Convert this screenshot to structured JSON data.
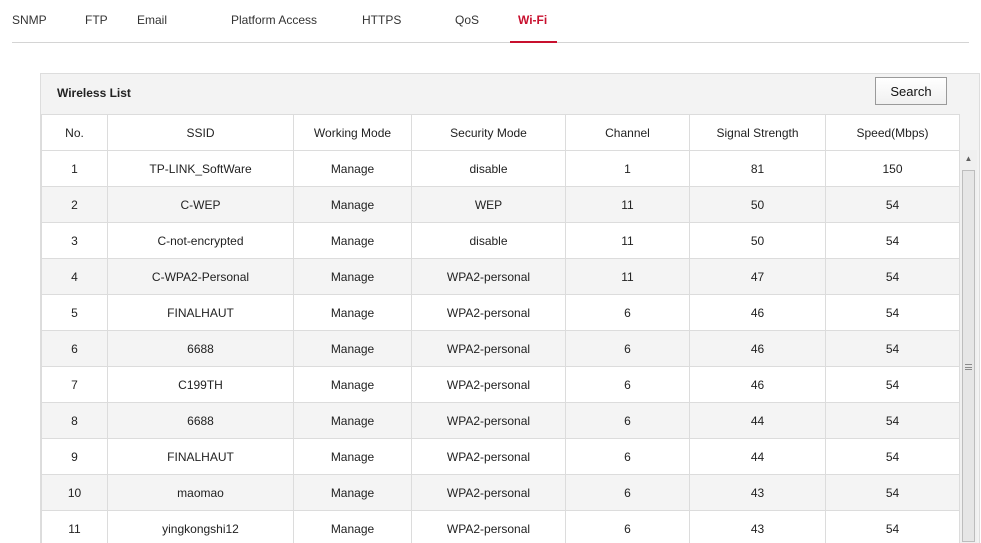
{
  "tabs": [
    {
      "label": "SNMP",
      "active": false
    },
    {
      "label": "FTP",
      "active": false
    },
    {
      "label": "Email",
      "active": false
    },
    {
      "label": "Platform Access",
      "active": false
    },
    {
      "label": "HTTPS",
      "active": false
    },
    {
      "label": "QoS",
      "active": false
    },
    {
      "label": "Wi-Fi",
      "active": true
    }
  ],
  "colors": {
    "accent": "#c8102e",
    "panel_background": "#f3f3f3",
    "row_alternate": "#f4f4f4"
  },
  "wireless_list": {
    "title": "Wireless List",
    "search_label": "Search",
    "columns": [
      "No.",
      "SSID",
      "Working Mode",
      "Security Mode",
      "Channel",
      "Signal Strength",
      "Speed(Mbps)"
    ],
    "rows": [
      [
        "1",
        "TP-LINK_SoftWare",
        "Manage",
        "disable",
        "1",
        "81",
        "150"
      ],
      [
        "2",
        "C-WEP",
        "Manage",
        "WEP",
        "11",
        "50",
        "54"
      ],
      [
        "3",
        "C-not-encrypted",
        "Manage",
        "disable",
        "11",
        "50",
        "54"
      ],
      [
        "4",
        "C-WPA2-Personal",
        "Manage",
        "WPA2-personal",
        "11",
        "47",
        "54"
      ],
      [
        "5",
        "FINALHAUT",
        "Manage",
        "WPA2-personal",
        "6",
        "46",
        "54"
      ],
      [
        "6",
        "6688",
        "Manage",
        "WPA2-personal",
        "6",
        "46",
        "54"
      ],
      [
        "7",
        "C199TH",
        "Manage",
        "WPA2-personal",
        "6",
        "46",
        "54"
      ],
      [
        "8",
        "6688",
        "Manage",
        "WPA2-personal",
        "6",
        "44",
        "54"
      ],
      [
        "9",
        "FINALHAUT",
        "Manage",
        "WPA2-personal",
        "6",
        "44",
        "54"
      ],
      [
        "10",
        "maomao",
        "Manage",
        "WPA2-personal",
        "6",
        "43",
        "54"
      ],
      [
        "11",
        "yingkongshi12",
        "Manage",
        "WPA2-personal",
        "6",
        "43",
        "54"
      ]
    ]
  },
  "scrollbar": {
    "up_arrow_icon": "triangle-up-icon",
    "grip_icon": "scroll-grip-icon"
  }
}
